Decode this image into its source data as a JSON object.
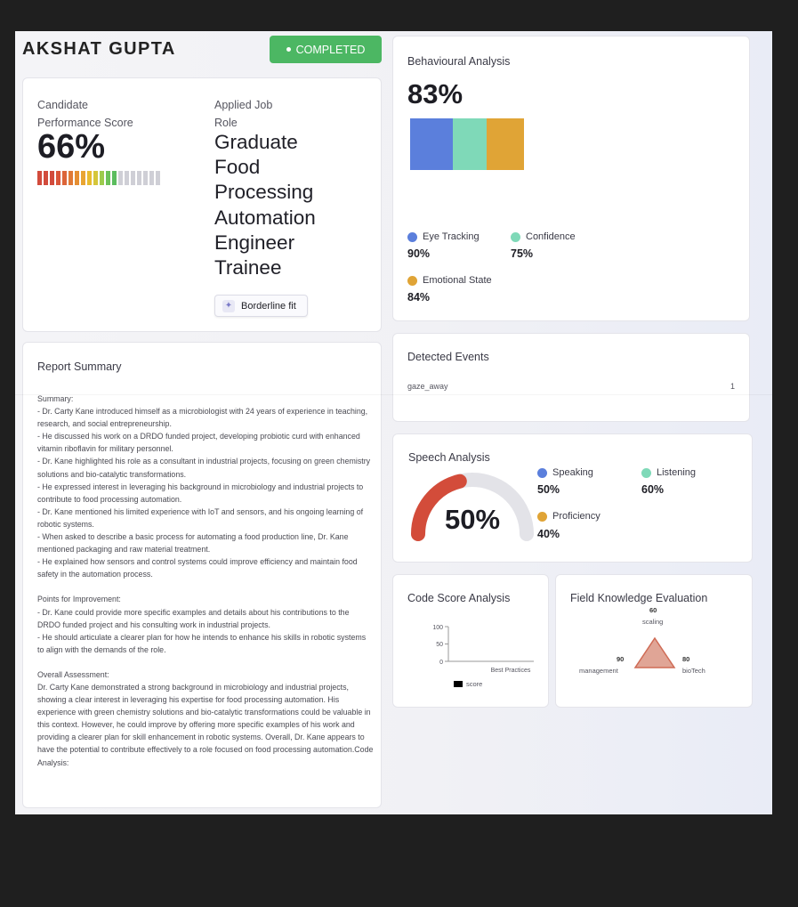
{
  "candidate": {
    "name": "AKSHAT GUPTA",
    "status": "COMPLETED"
  },
  "performance": {
    "label_line1": "Candidate",
    "label_line2": "Performance Score",
    "score": "66%",
    "score_fraction": 0.66,
    "segment_colors": [
      "#d24b3c",
      "#d24b3c",
      "#d24b3c",
      "#d9563a",
      "#dc6438",
      "#e07a36",
      "#e58f33",
      "#e9a532",
      "#e8bb2f",
      "#d5c63a",
      "#9ccb4d",
      "#6cc15a",
      "#5bbd5e",
      "#cfcfd6",
      "#cfcfd6",
      "#cfcfd6",
      "#cfcfd6",
      "#cfcfd6",
      "#cfcfd6",
      "#cfcfd6"
    ],
    "role_label_line1": "Applied Job",
    "role_label_line2": "Role",
    "role_lines": [
      "Graduate",
      "Food",
      "Processing",
      "Automation",
      "Engineer",
      "Trainee"
    ],
    "fit_label": "Borderline fit"
  },
  "behavioural": {
    "title": "Behavioural Analysis",
    "score": "83%",
    "items": [
      {
        "label": "Eye Tracking",
        "value": "90%",
        "color": "#5b7fdc"
      },
      {
        "label": "Confidence",
        "value": "75%",
        "color": "#7fd9b8"
      },
      {
        "label": "Emotional State",
        "value": "84%",
        "color": "#e0a436"
      }
    ]
  },
  "report": {
    "title": "Report Summary",
    "summary": "Summary:\n- Dr. Carty Kane introduced himself as a microbiologist with 24 years of experience in teaching, research, and social entrepreneurship.\n- He discussed his work on a DRDO funded project, developing probiotic curd with enhanced vitamin riboflavin for military personnel.\n- Dr. Kane highlighted his role as a consultant in industrial projects, focusing on green chemistry solutions and bio-catalytic transformations.\n- He expressed interest in leveraging his background in microbiology and industrial projects to contribute to food processing automation.\n- Dr. Kane mentioned his limited experience with IoT and sensors, and his ongoing learning of robotic systems.\n- When asked to describe a basic process for automating a food production line, Dr. Kane mentioned packaging and raw material treatment.\n- He explained how sensors and control systems could improve efficiency and maintain food safety in the automation process.",
    "improvement": "Points for Improvement:\n- Dr. Kane could provide more specific examples and details about his contributions to the DRDO funded project and his consulting work in industrial projects.\n- He should articulate a clearer plan for how he intends to enhance his skills in robotic systems to align with the demands of the role.",
    "overall": "Overall Assessment:\nDr. Carty Kane demonstrated a strong background in microbiology and industrial projects, showing a clear interest in leveraging his expertise for food processing automation. His experience with green chemistry solutions and bio-catalytic transformations could be valuable in this context. However, he could improve by offering more specific examples of his work and providing a clearer plan for skill enhancement in robotic systems. Overall, Dr. Kane appears to have the potential to contribute effectively to a role focused on food processing automation.Code Analysis:"
  },
  "events": {
    "title": "Detected Events",
    "rows": [
      {
        "name": "gaze_away",
        "count": "1"
      }
    ]
  },
  "speech": {
    "title": "Speech Analysis",
    "score": "50%",
    "gauge_fraction": 0.5,
    "items": [
      {
        "label": "Speaking",
        "value": "50%",
        "color": "#5b7fdc"
      },
      {
        "label": "Listening",
        "value": "60%",
        "color": "#7fd9b8"
      },
      {
        "label": "Proficiency",
        "value": "40%",
        "color": "#e0a436"
      }
    ]
  },
  "code_score": {
    "title": "Code Score Analysis",
    "chart_data": {
      "type": "bar",
      "categories": [
        "Best Practices"
      ],
      "series": [
        {
          "name": "score",
          "values": [
            0
          ]
        }
      ],
      "yticks": [
        "100",
        "50",
        "0"
      ],
      "ylim": [
        0,
        100
      ]
    }
  },
  "field_knowledge": {
    "title": "Field Knowledge Evaluation",
    "chart_data": {
      "type": "radar",
      "axes": [
        {
          "label": "scaling",
          "value": "60"
        },
        {
          "label": "bioTech",
          "value": "80"
        },
        {
          "label": "management",
          "value": "90"
        }
      ]
    }
  }
}
